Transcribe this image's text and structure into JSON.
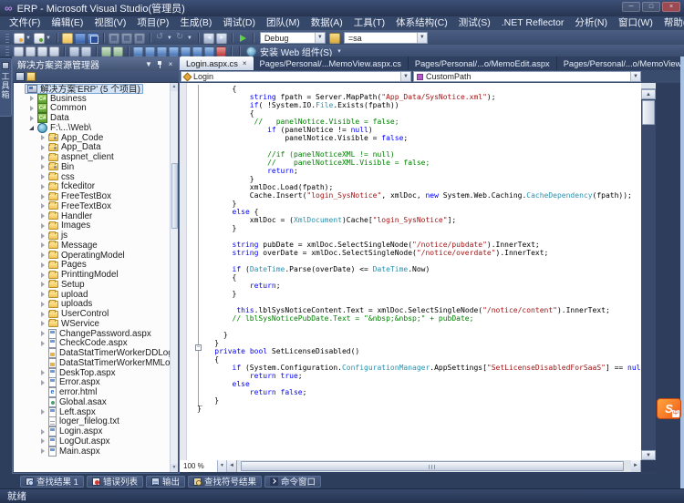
{
  "window": {
    "title": "ERP - Microsoft Visual Studio(管理员)",
    "logo": "∞",
    "controls": [
      {
        "name": "minimize",
        "glyph": "─"
      },
      {
        "name": "maximize",
        "glyph": "□"
      },
      {
        "name": "close",
        "glyph": "×"
      }
    ]
  },
  "menu": {
    "items": [
      "文件(F)",
      "编辑(E)",
      "视图(V)",
      "项目(P)",
      "生成(B)",
      "调试(D)",
      "团队(M)",
      "数据(A)",
      "工具(T)",
      "体系结构(C)",
      "测试(S)",
      ".NET Reflector",
      "分析(N)",
      "窗口(W)",
      "帮助(H)"
    ]
  },
  "toolbar_main": {
    "groups": [
      {
        "icons": [
          {
            "n": "new-project",
            "caret": true
          },
          {
            "n": "add-item",
            "caret": true
          }
        ]
      },
      {
        "icons": [
          {
            "n": "open-folder"
          },
          {
            "n": "save"
          },
          {
            "n": "save-all"
          }
        ]
      },
      {
        "icons": [
          {
            "n": "cut",
            "dim": true
          },
          {
            "n": "copy",
            "dim": true
          },
          {
            "n": "paste",
            "dim": true
          }
        ]
      },
      {
        "icons": [
          {
            "n": "undo",
            "caret": true,
            "dim": true
          },
          {
            "n": "redo",
            "caret": true,
            "dim": true
          }
        ]
      },
      {
        "icons": [
          {
            "n": "navigate-back"
          },
          {
            "n": "navigate-forward"
          }
        ]
      },
      {
        "icons": [
          {
            "n": "start-debug"
          }
        ]
      }
    ],
    "debug_combo": {
      "value": "Debug"
    },
    "solution_platform_icon": "solution-platform",
    "find_combo": {
      "value": "=sa"
    }
  },
  "toolbar_secondary": {
    "groups": [
      {
        "icons": [
          {
            "n": "layout-1"
          },
          {
            "n": "layout-2"
          },
          {
            "n": "layout-3"
          },
          {
            "n": "layout-4"
          }
        ]
      },
      {
        "icons": [
          {
            "n": "indent-decrease"
          },
          {
            "n": "indent-increase"
          }
        ]
      },
      {
        "icons": [
          {
            "n": "comment"
          },
          {
            "n": "uncomment"
          }
        ]
      },
      {
        "icons": [
          {
            "n": "web-1"
          },
          {
            "n": "web-2"
          },
          {
            "n": "web-3"
          },
          {
            "n": "web-4"
          },
          {
            "n": "web-5"
          },
          {
            "n": "web-6"
          },
          {
            "n": "web-7"
          },
          {
            "n": "stop-red"
          }
        ]
      }
    ],
    "install_web_button": {
      "label": "安装 Web 组件(S)"
    },
    "overflow_glyph": "▾"
  },
  "toolbox_tab": {
    "label": "工具箱"
  },
  "solution_explorer": {
    "title": "解决方案资源管理器",
    "toolbar_icons": [
      {
        "n": "properties"
      },
      {
        "n": "show-all-files"
      }
    ],
    "tree": [
      {
        "label": "解决方案'ERP' (5 个项目)",
        "icon": "solution",
        "level": 0,
        "expand": "none",
        "selected": true
      },
      {
        "label": "Business",
        "icon": "csproj",
        "level": 1,
        "expand": "collapsed"
      },
      {
        "label": "Common",
        "icon": "csproj",
        "level": 1,
        "expand": "collapsed"
      },
      {
        "label": "Data",
        "icon": "csproj",
        "level": 1,
        "expand": "collapsed"
      },
      {
        "label": "F:\\...\\Web\\",
        "icon": "webproj",
        "level": 1,
        "expand": "expanded"
      },
      {
        "label": "App_Code",
        "icon": "folder-code",
        "level": 2,
        "expand": "collapsed"
      },
      {
        "label": "App_Data",
        "icon": "folder-data",
        "level": 2,
        "expand": "collapsed"
      },
      {
        "label": "aspnet_client",
        "icon": "folder",
        "level": 2,
        "expand": "collapsed"
      },
      {
        "label": "Bin",
        "icon": "folder-bin",
        "level": 2,
        "expand": "collapsed"
      },
      {
        "label": "css",
        "icon": "folder",
        "level": 2,
        "expand": "collapsed"
      },
      {
        "label": "fckeditor",
        "icon": "folder",
        "level": 2,
        "expand": "collapsed"
      },
      {
        "label": "FreeTestBox",
        "icon": "folder",
        "level": 2,
        "expand": "collapsed"
      },
      {
        "label": "FreeTextBox",
        "icon": "folder",
        "level": 2,
        "expand": "collapsed"
      },
      {
        "label": "Handler",
        "icon": "folder",
        "level": 2,
        "expand": "collapsed"
      },
      {
        "label": "Images",
        "icon": "folder",
        "level": 2,
        "expand": "collapsed"
      },
      {
        "label": "js",
        "icon": "folder",
        "level": 2,
        "expand": "collapsed"
      },
      {
        "label": "Message",
        "icon": "folder",
        "level": 2,
        "expand": "collapsed"
      },
      {
        "label": "OperatingModel",
        "icon": "folder",
        "level": 2,
        "expand": "collapsed"
      },
      {
        "label": "Pages",
        "icon": "folder",
        "level": 2,
        "expand": "collapsed"
      },
      {
        "label": "PrinttingModel",
        "icon": "folder",
        "level": 2,
        "expand": "collapsed"
      },
      {
        "label": "Setup",
        "icon": "folder",
        "level": 2,
        "expand": "collapsed"
      },
      {
        "label": "upload",
        "icon": "folder",
        "level": 2,
        "expand": "collapsed"
      },
      {
        "label": "uploads",
        "icon": "folder",
        "level": 2,
        "expand": "collapsed"
      },
      {
        "label": "UserControl",
        "icon": "folder",
        "level": 2,
        "expand": "collapsed"
      },
      {
        "label": "WService",
        "icon": "folder",
        "level": 2,
        "expand": "collapsed"
      },
      {
        "label": "ChangePassword.aspx",
        "icon": "aspx",
        "level": 2,
        "expand": "collapsed"
      },
      {
        "label": "CheckCode.aspx",
        "icon": "aspx",
        "level": 2,
        "expand": "collapsed"
      },
      {
        "label": "DataStatTimerWorkerDDLog.xml",
        "icon": "xml",
        "level": 2,
        "expand": "none"
      },
      {
        "label": "DataStatTimerWorkerMMLog.xml",
        "icon": "xml",
        "level": 2,
        "expand": "none"
      },
      {
        "label": "DeskTop.aspx",
        "icon": "aspx",
        "level": 2,
        "expand": "collapsed"
      },
      {
        "label": "Error.aspx",
        "icon": "aspx",
        "level": 2,
        "expand": "collapsed"
      },
      {
        "label": "error.html",
        "icon": "html",
        "level": 2,
        "expand": "none"
      },
      {
        "label": "Global.asax",
        "icon": "asax",
        "level": 2,
        "expand": "none"
      },
      {
        "label": "Left.aspx",
        "icon": "aspx",
        "level": 2,
        "expand": "collapsed"
      },
      {
        "label": "loger_filelog.txt",
        "icon": "txt",
        "level": 2,
        "expand": "none"
      },
      {
        "label": "Login.aspx",
        "icon": "aspx",
        "level": 2,
        "expand": "collapsed"
      },
      {
        "label": "LogOut.aspx",
        "icon": "aspx",
        "level": 2,
        "expand": "collapsed"
      },
      {
        "label": "Main.aspx",
        "icon": "aspx",
        "level": 2,
        "expand": "collapsed"
      }
    ]
  },
  "editor": {
    "tabs": [
      {
        "label": "Login.aspx.cs",
        "active": true,
        "close": "×"
      },
      {
        "label": "Pages/Personal/...MemoView.aspx.cs"
      },
      {
        "label": "Pages/Personal/...o/MemoEdit.aspx"
      },
      {
        "label": "Pages/Personal/...o/MemoView.aspx"
      }
    ],
    "nav": {
      "class_combo": "Login",
      "method_combo": "CustomPath"
    },
    "zoom": "100 %",
    "code_lines": [
      {
        "t": [
          [
            "p",
            "        {"
          ]
        ]
      },
      {
        "t": [
          [
            "p",
            "            "
          ],
          [
            "k",
            "string"
          ],
          [
            "p",
            " fpath = Server.MapPath("
          ],
          [
            "s",
            "\"App_Data/SysNotice.xml\""
          ],
          [
            "p",
            ");"
          ]
        ]
      },
      {
        "t": [
          [
            "p",
            "            "
          ],
          [
            "k",
            "if"
          ],
          [
            "p",
            "( !System.IO."
          ],
          [
            "t",
            "File"
          ],
          [
            "p",
            ".Exists(fpath))"
          ]
        ]
      },
      {
        "t": [
          [
            "p",
            "            {"
          ]
        ]
      },
      {
        "t": [
          [
            "c",
            "             //   panelNotice.Visible = false;"
          ]
        ]
      },
      {
        "t": [
          [
            "p",
            "                "
          ],
          [
            "k",
            "if"
          ],
          [
            "p",
            " (panelNotice != "
          ],
          [
            "k",
            "null"
          ],
          [
            "p",
            ")"
          ]
        ]
      },
      {
        "t": [
          [
            "p",
            "                    panelNotice.Visible = "
          ],
          [
            "k",
            "false"
          ],
          [
            "p",
            ";"
          ]
        ]
      },
      {
        "t": []
      },
      {
        "t": [
          [
            "c",
            "                //if (panelNoticeXML != null)"
          ]
        ]
      },
      {
        "t": [
          [
            "c",
            "                //    panelNoticeXML.Visible = false;"
          ]
        ]
      },
      {
        "t": [
          [
            "p",
            "                "
          ],
          [
            "k",
            "return"
          ],
          [
            "p",
            ";"
          ]
        ]
      },
      {
        "t": [
          [
            "p",
            "            }"
          ]
        ]
      },
      {
        "t": [
          [
            "p",
            "            xmlDoc.Load(fpath);"
          ]
        ]
      },
      {
        "t": [
          [
            "p",
            "            Cache.Insert("
          ],
          [
            "s",
            "\"login_SysNotice\""
          ],
          [
            "p",
            ", xmlDoc, "
          ],
          [
            "k",
            "new"
          ],
          [
            "p",
            " System.Web.Caching."
          ],
          [
            "t",
            "CacheDependency"
          ],
          [
            "p",
            "(fpath));"
          ]
        ]
      },
      {
        "t": [
          [
            "p",
            "        }"
          ]
        ]
      },
      {
        "t": [
          [
            "p",
            "        "
          ],
          [
            "k",
            "else"
          ],
          [
            "p",
            " {"
          ]
        ]
      },
      {
        "t": [
          [
            "p",
            "            xmlDoc = ("
          ],
          [
            "t",
            "XmlDocument"
          ],
          [
            "p",
            ")Cache["
          ],
          [
            "s",
            "\"login_SysNotice\""
          ],
          [
            "p",
            "];"
          ]
        ]
      },
      {
        "t": [
          [
            "p",
            "        }"
          ]
        ]
      },
      {
        "t": []
      },
      {
        "t": [
          [
            "p",
            "        "
          ],
          [
            "k",
            "string"
          ],
          [
            "p",
            " pubDate = xmlDoc.SelectSingleNode("
          ],
          [
            "s",
            "\"/notice/pubdate\""
          ],
          [
            "p",
            ").InnerText;"
          ]
        ]
      },
      {
        "t": [
          [
            "p",
            "        "
          ],
          [
            "k",
            "string"
          ],
          [
            "p",
            " overDate = xmlDoc.SelectSingleNode("
          ],
          [
            "s",
            "\"/notice/overdate\""
          ],
          [
            "p",
            ").InnerText;"
          ]
        ]
      },
      {
        "t": []
      },
      {
        "t": [
          [
            "p",
            "        "
          ],
          [
            "k",
            "if"
          ],
          [
            "p",
            " ("
          ],
          [
            "t",
            "DateTime"
          ],
          [
            "p",
            ".Parse(overDate) <= "
          ],
          [
            "t",
            "DateTime"
          ],
          [
            "p",
            ".Now)"
          ]
        ]
      },
      {
        "t": [
          [
            "p",
            "        {"
          ]
        ]
      },
      {
        "t": [
          [
            "p",
            "            "
          ],
          [
            "k",
            "return"
          ],
          [
            "p",
            ";"
          ]
        ]
      },
      {
        "t": [
          [
            "p",
            "        }"
          ]
        ]
      },
      {
        "t": []
      },
      {
        "t": [
          [
            "p",
            "         "
          ],
          [
            "k",
            "this"
          ],
          [
            "p",
            ".lblSysNoticeContent.Text = xmlDoc.SelectSingleNode("
          ],
          [
            "s",
            "\"/notice/content\""
          ],
          [
            "p",
            ").InnerText;"
          ]
        ]
      },
      {
        "t": [
          [
            "c",
            "        // lblSysNoticePubDate.Text = \"&nbsp;&nbsp;\" + pubDate;"
          ]
        ]
      },
      {
        "t": []
      },
      {
        "t": [
          [
            "p",
            "      }"
          ]
        ]
      },
      {
        "t": [
          [
            "p",
            "    }"
          ]
        ]
      },
      {
        "t": [
          [
            "p",
            "    "
          ],
          [
            "k",
            "private"
          ],
          [
            "p",
            " "
          ],
          [
            "k",
            "bool"
          ],
          [
            "p",
            " SetLicenseDisabled()"
          ]
        ]
      },
      {
        "t": [
          [
            "p",
            "    {"
          ]
        ]
      },
      {
        "t": [
          [
            "p",
            "        "
          ],
          [
            "k",
            "if"
          ],
          [
            "p",
            " (System.Configuration."
          ],
          [
            "t",
            "ConfigurationManager"
          ],
          [
            "p",
            ".AppSettings["
          ],
          [
            "s",
            "\"SetLicenseDisabledForSaaS\""
          ],
          [
            "p",
            "] == "
          ],
          [
            "k",
            "null"
          ],
          [
            "p",
            ")"
          ]
        ]
      },
      {
        "t": [
          [
            "p",
            "            "
          ],
          [
            "k",
            "return"
          ],
          [
            "p",
            " "
          ],
          [
            "k",
            "true"
          ],
          [
            "p",
            ";"
          ]
        ]
      },
      {
        "t": [
          [
            "p",
            "        "
          ],
          [
            "k",
            "else"
          ]
        ]
      },
      {
        "t": [
          [
            "p",
            "            "
          ],
          [
            "k",
            "return"
          ],
          [
            "p",
            " "
          ],
          [
            "k",
            "false"
          ],
          [
            "p",
            ";"
          ]
        ]
      },
      {
        "t": [
          [
            "p",
            "    }"
          ]
        ]
      },
      {
        "t": [
          [
            "p",
            "}"
          ]
        ]
      }
    ]
  },
  "bottom_panel_tabs": [
    {
      "label": "查找结果 1",
      "icon": "find-results"
    },
    {
      "label": "错误列表",
      "icon": "error-list"
    },
    {
      "label": "输出",
      "icon": "output"
    },
    {
      "label": "查找符号结果",
      "icon": "find-symbol"
    },
    {
      "label": "命令窗口",
      "icon": "command-window"
    }
  ],
  "status_bar": {
    "text": "就绪"
  },
  "ime": {
    "label": "S",
    "badge": "中"
  },
  "colors": {
    "chrome": "#3b4d70",
    "titlebar": "#2b3a57",
    "editor_bg": "#ffffff",
    "keyword": "#0000ff",
    "string": "#a31515",
    "comment": "#008000",
    "type": "#2b91af",
    "plain": "#000000",
    "selection_bg": "#d3e3f8",
    "selection_border": "#7ea2cf"
  }
}
